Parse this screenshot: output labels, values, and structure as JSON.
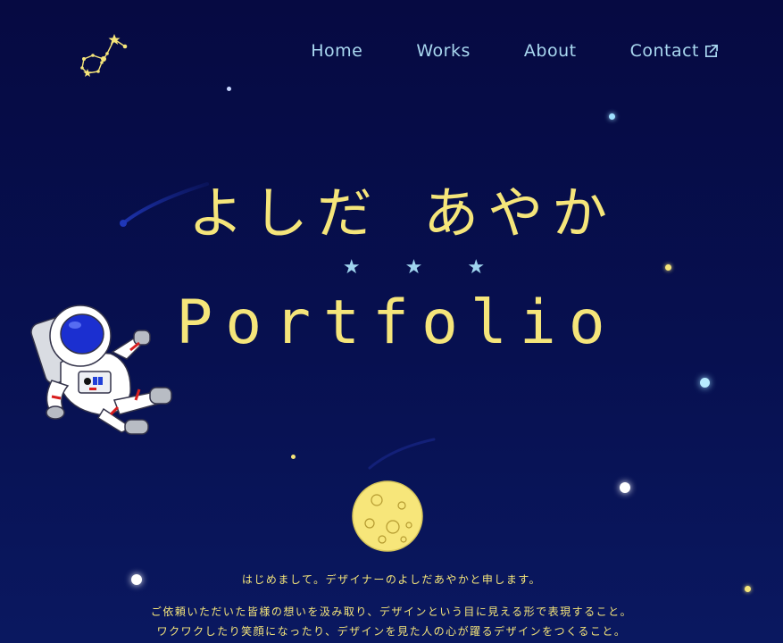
{
  "nav": {
    "items": [
      {
        "label": "Home"
      },
      {
        "label": "Works"
      },
      {
        "label": "About"
      },
      {
        "label": "Contact",
        "icon": "external-link-icon"
      }
    ]
  },
  "hero": {
    "name_jp": "よしだ あやか",
    "divider_stars": "★★★",
    "subtitle": "Portfolio"
  },
  "intro": {
    "line1": "はじめまして。デザイナーのよしだあやかと申します。",
    "line2": "ご依頼いただいた皆様の想いを汲み取り、デザインという目に見える形で表現すること。",
    "line3": "ワクワクしたり笑顔になったり、デザインを見た人の心が躍るデザインをつくること。"
  },
  "colors": {
    "background": "#060a42",
    "accent_yellow": "#f5e57a",
    "accent_blue": "#a9d8f0"
  },
  "icons": [
    "constellation-logo-icon",
    "external-link-icon",
    "astronaut-icon",
    "moon-icon",
    "shooting-star-icon"
  ]
}
